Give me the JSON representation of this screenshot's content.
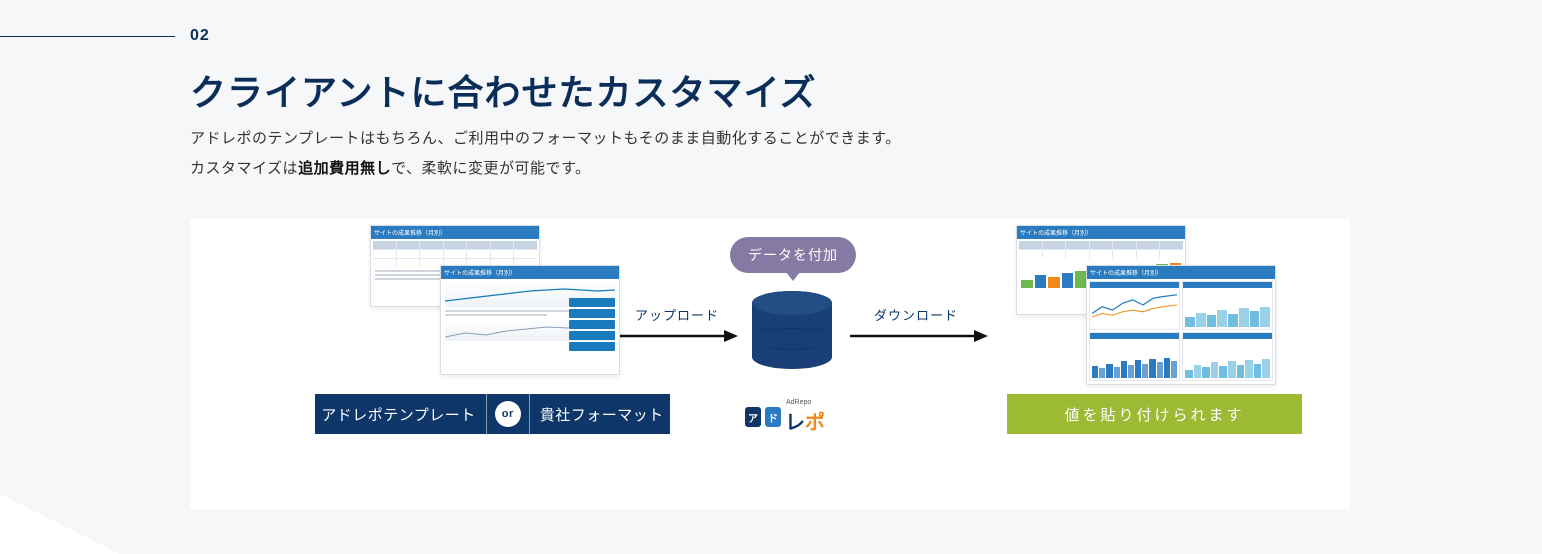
{
  "section_number": "02",
  "heading": "クライアントに合わせたカスタマイズ",
  "desc_line1": "アドレポのテンプレートはもちろん、ご利用中のフォーマットもそのまま自動化することができます。",
  "desc_line2_a": "カスタマイズは",
  "desc_line2_em": "追加費用無し",
  "desc_line2_b": "で、柔軟に変更が可能です。",
  "left_label_a": "アドレポテンプレート",
  "left_label_or": "or",
  "left_label_b": "貴社フォーマット",
  "bubble": "データを付加",
  "arrow_upload": "アップロード",
  "arrow_download": "ダウンロード",
  "brand_box1": "ア",
  "brand_box2": "ド",
  "brand_sup": "AdRepo",
  "brand_le": "レ",
  "brand_po": "ポ",
  "right_label": "値を貼り付けられます",
  "sheet_header": "サイトの成果推移（月別）"
}
